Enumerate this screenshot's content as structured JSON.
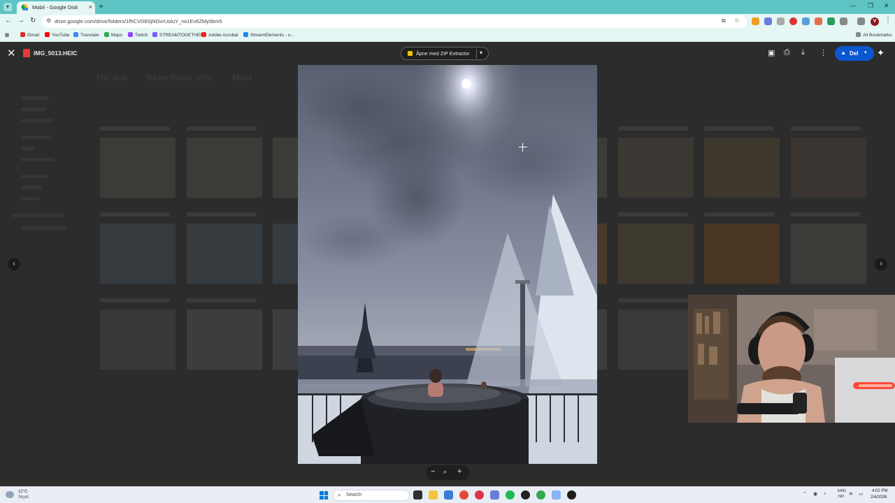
{
  "browser": {
    "tab_title": "Mobil - Google Disk",
    "url": "drive.google.com/drive/folders/1fhCVD8SjNOvrUoluY_rw1Ev6ZMy5bm5",
    "bookmarks": [
      "Gmail",
      "YouTube",
      "Translate",
      "Maps",
      "Twitch",
      "STREAMTOGETHER",
      "Adobe Acrobat",
      "StreamElements - o..."
    ],
    "all_bookmarks": "All Bookmarks",
    "profile_initial": "V"
  },
  "viewer": {
    "file_name": "IMG_5013.HEIC",
    "open_with_label": "Åpne med ZIP Extractor",
    "share_label": "Del"
  },
  "drive_background": {
    "breadcrumb": [
      "Min disk",
      "Bilder fronte rythe",
      "Mobil"
    ]
  },
  "taskbar": {
    "weather_temp": "12°C",
    "weather_desc": "Skyet",
    "search_placeholder": "Search",
    "lang_line1": "ENG",
    "lang_line2": "NO",
    "time": "4:02 PM",
    "date": "2/4/2026"
  },
  "colors": {
    "tab_bar": "#5ec4c4",
    "toolbar": "#e5f6f5",
    "share_button": "#0b57d0",
    "viewer_background": "#2c2c2d"
  }
}
